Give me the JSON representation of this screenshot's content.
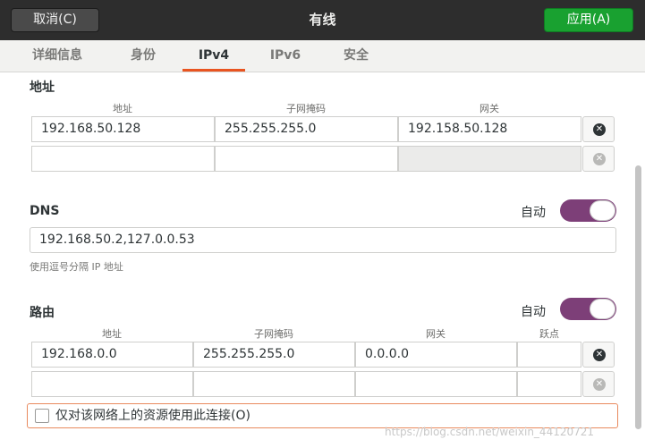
{
  "header": {
    "cancel_label": "取消(C)",
    "title": "有线",
    "apply_label": "应用(A)"
  },
  "tabs": [
    {
      "label": "详细信息"
    },
    {
      "label": "身份"
    },
    {
      "label": "IPv4"
    },
    {
      "label": "IPv6"
    },
    {
      "label": "安全"
    }
  ],
  "active_tab": "IPv4",
  "address": {
    "section_title": "地址",
    "columns": [
      "地址",
      "子网掩码",
      "网关"
    ],
    "rows": [
      [
        "192.168.50.128",
        "255.255.255.0",
        "192.158.50.128"
      ],
      [
        "",
        "",
        ""
      ]
    ]
  },
  "dns": {
    "section_title": "DNS",
    "auto_label": "自动",
    "auto_enabled": true,
    "value": "192.168.50.2,127.0.0.53",
    "hint": "使用逗号分隔 IP 地址"
  },
  "routes": {
    "section_title": "路由",
    "auto_label": "自动",
    "auto_enabled": true,
    "columns": [
      "地址",
      "子网掩码",
      "网关",
      "跃点"
    ],
    "rows": [
      [
        "192.168.0.0",
        "255.255.255.0",
        "0.0.0.0",
        ""
      ],
      [
        "",
        "",
        "",
        ""
      ]
    ],
    "only_local_label": "仅对该网络上的资源使用此连接(O)",
    "only_local_checked": false
  },
  "colors": {
    "accent": "#e95420",
    "apply_green": "#19a130",
    "switch_on": "#7d3f78",
    "header_bg": "#2d2d2d"
  },
  "icons": {
    "delete_row": "close-circle-icon"
  },
  "watermark": "https://blog.csdn.net/weixin_44120721"
}
